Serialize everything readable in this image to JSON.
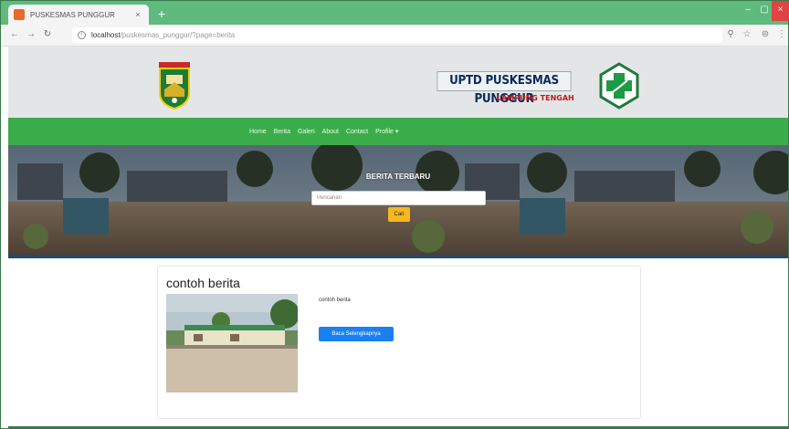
{
  "browser": {
    "tab_title": "PUSKESMAS PUNGGUR",
    "tab_close": "×",
    "new_tab": "+",
    "minimize": "–",
    "maximize": "▢",
    "close": "×",
    "url_host": "localhost",
    "url_path": "/puskesmas_punggur/?page=berita",
    "back": "←",
    "forward": "→",
    "reload": "↻",
    "zoom_icon": "⚲",
    "star_icon": "☆",
    "ext_icon": "⊜",
    "menu_icon": "⋮"
  },
  "header": {
    "banner_title": "UPTD PUSKESMAS PUNGGUR",
    "banner_subtitle": "LAMPUNG TENGAH"
  },
  "nav": {
    "items": [
      "Home",
      "Berita",
      "Galeri",
      "About",
      "Contact",
      "Profile ▾"
    ]
  },
  "hero": {
    "title": "BERITA TERBARU",
    "search_placeholder": "Pencarian",
    "search_button": "Cari"
  },
  "news": {
    "title": "contoh berita",
    "excerpt": "contoh berita",
    "read_more": "Baca Selengkapnya"
  },
  "colors": {
    "tab_strip": "#5fba7d",
    "navbar": "#3aad4a",
    "search_button": "#f6b722",
    "read_more": "#1a80f2",
    "banner_subtitle": "#c21818"
  }
}
